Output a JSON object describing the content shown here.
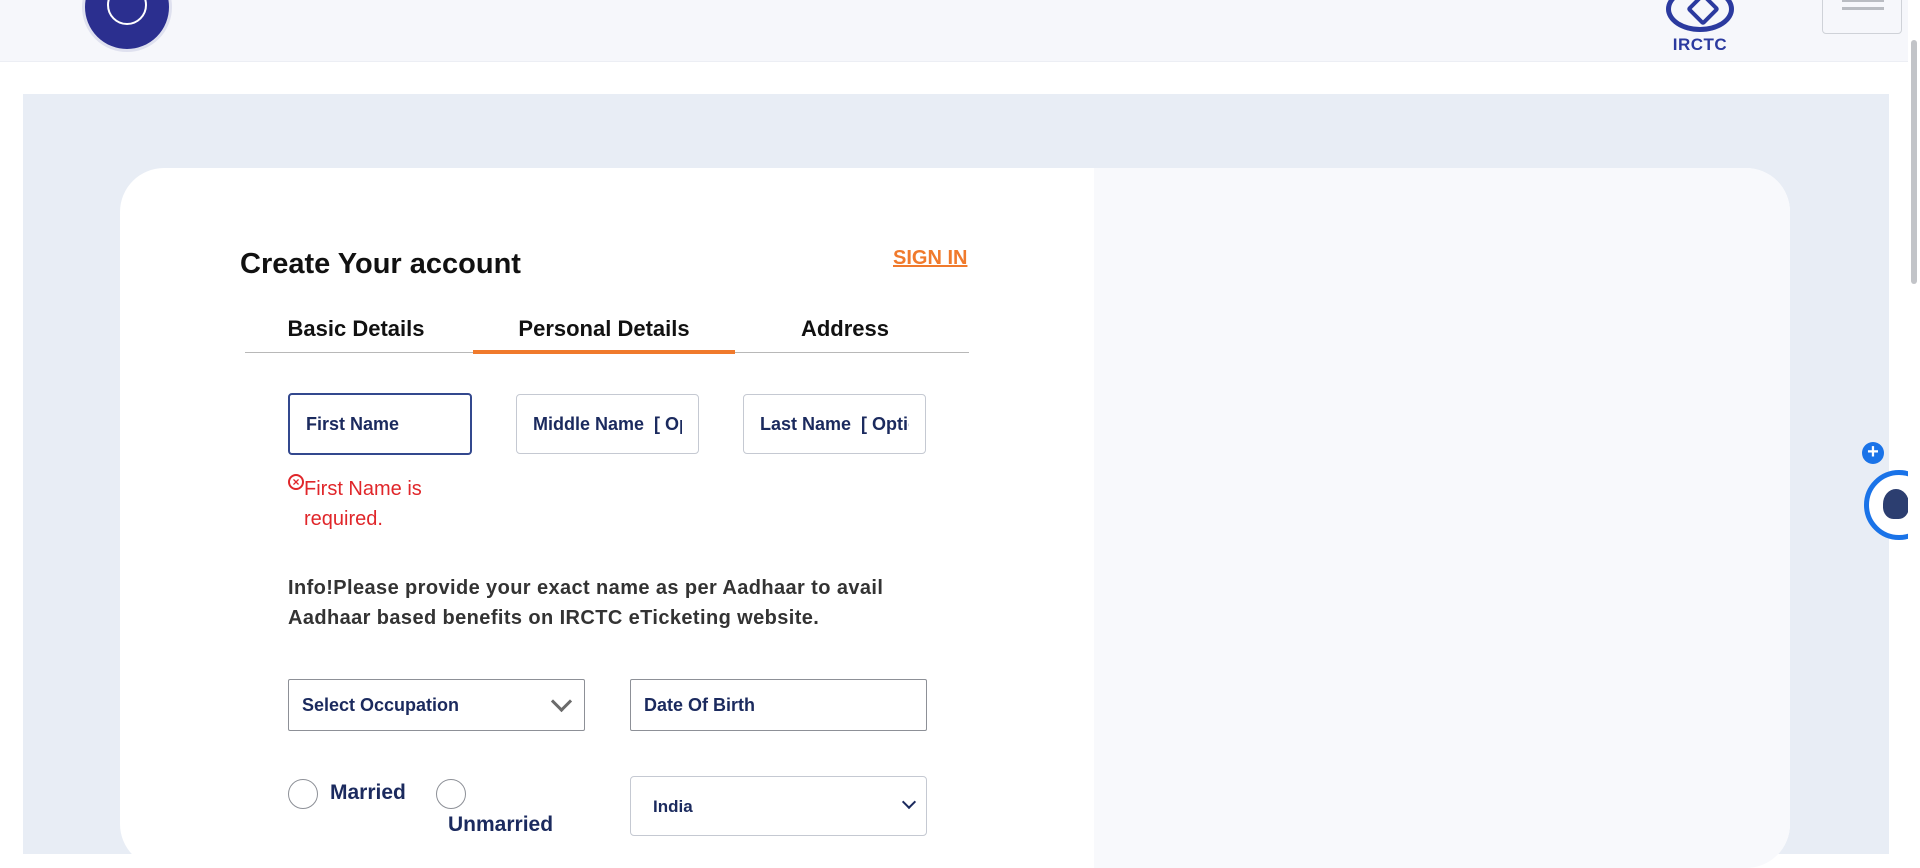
{
  "header": {
    "logo_text": "IRCTC"
  },
  "form": {
    "title": "Create Your account",
    "signin_label": "SIGN IN",
    "tabs": [
      {
        "label": "Basic Details",
        "active": false
      },
      {
        "label": "Personal Details",
        "active": true
      },
      {
        "label": "Address",
        "active": false
      }
    ],
    "first_name": {
      "placeholder": "First Name",
      "value": ""
    },
    "middle_name": {
      "placeholder": "Middle Name  [ Optional ]",
      "value": ""
    },
    "last_name": {
      "placeholder": "Last Name  [ Optional ]",
      "value": ""
    },
    "error_text": "First Name is required.",
    "info_text": "Info!Please provide your exact name as per Aadhaar to avail Aadhaar based benefits on IRCTC eTicketing website.",
    "occupation_placeholder": "Select Occupation",
    "dob_placeholder": "Date Of Birth",
    "marital_options": [
      "Married",
      "Unmarried"
    ],
    "country_selected": "India"
  },
  "colors": {
    "accent": "#f07a2c",
    "navy": "#1b2a5e",
    "error": "#e0262a",
    "chatbot_blue": "#1a73e8"
  }
}
